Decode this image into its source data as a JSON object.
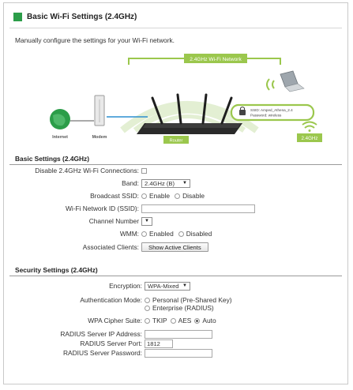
{
  "header": {
    "title": "Basic Wi-Fi Settings (2.4GHz)"
  },
  "description": "Manually configure the settings for your Wi-Fi network.",
  "diagram": {
    "network_label": "2.4GHz Wi-Fi Network",
    "internet_label": "Internet",
    "modem_label": "Modem",
    "router_label": "Router",
    "ssid_line": "SSID: Amped_Athena_2.4",
    "password_line": "Password: wireless",
    "band_badge": "2.4GHz",
    "colors": {
      "accent": "#9bc74d",
      "green": "#2c9d49",
      "router": "#222222"
    }
  },
  "basic": {
    "section_title": "Basic Settings (2.4GHz)",
    "disable_label": "Disable 2.4GHz Wi-Fi Connections:",
    "disable_checked": false,
    "band_label": "Band:",
    "band_value": "2.4GHz (B)",
    "broadcast_label": "Broadcast SSID:",
    "broadcast_options": [
      "Enable",
      "Disable"
    ],
    "ssid_label": "Wi-Fi Network ID (SSID):",
    "ssid_value": "",
    "channel_label": "Channel Number",
    "channel_value": "",
    "wmm_label": "WMM:",
    "wmm_options": [
      "Enabled",
      "Disabled"
    ],
    "clients_label": "Associated Clients:",
    "clients_button": "Show Active Clients"
  },
  "security": {
    "section_title": "Security Settings (2.4GHz)",
    "encryption_label": "Encryption:",
    "encryption_value": "WPA-Mixed",
    "auth_label": "Authentication Mode:",
    "auth_options": [
      "Personal (Pre-Shared Key)",
      "Enterprise (RADIUS)"
    ],
    "cipher_label": "WPA Cipher Suite:",
    "cipher_options": [
      "TKIP",
      "AES",
      "Auto"
    ],
    "cipher_selected": "Auto",
    "radius_ip_label": "RADIUS Server IP Address:",
    "radius_ip_value": "",
    "radius_port_label": "RADIUS Server Port:",
    "radius_port_value": "1812",
    "radius_password_label": "RADIUS Server Password:",
    "radius_password_value": ""
  }
}
